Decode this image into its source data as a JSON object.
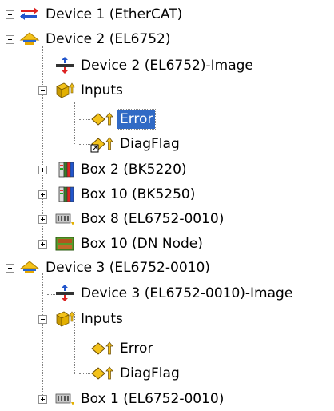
{
  "tree": {
    "selected_label": "Error",
    "nodes": [
      {
        "label": "Device 1 (EtherCAT)",
        "icon": "ethercat-device-icon",
        "expanded": false
      },
      {
        "label": "Device 2 (EL6752)",
        "icon": "device-icon",
        "expanded": true
      },
      {
        "label": "Device 2 (EL6752)-Image",
        "icon": "image-icon"
      },
      {
        "label": "Inputs",
        "icon": "inputs-icon",
        "expanded": true
      },
      {
        "label": "Error",
        "icon": "input-variable-icon",
        "selected": true
      },
      {
        "label": "DiagFlag",
        "icon": "linked-input-variable-icon"
      },
      {
        "label": "Box 2 (BK5220)",
        "icon": "bus-coupler-icon",
        "expanded": false
      },
      {
        "label": "Box 10 (BK5250)",
        "icon": "bus-coupler-icon",
        "expanded": false
      },
      {
        "label": "Box 8 (EL6752-0010)",
        "icon": "slave-box-icon",
        "expanded": false
      },
      {
        "label": "Box 10 (DN Node)",
        "icon": "dn-node-icon",
        "expanded": false
      },
      {
        "label": "Device 3 (EL6752-0010)",
        "icon": "device-icon",
        "expanded": true
      },
      {
        "label": "Device 3 (EL6752-0010)-Image",
        "icon": "image-icon"
      },
      {
        "label": "Inputs",
        "icon": "inputs-icon",
        "expanded": true
      },
      {
        "label": "Error",
        "icon": "input-variable-icon"
      },
      {
        "label": "DiagFlag",
        "icon": "input-variable-icon"
      },
      {
        "label": "Box 1 (EL6752-0010)",
        "icon": "slave-box-icon",
        "expanded": false
      }
    ]
  },
  "colors": {
    "selection": "#316ac5",
    "connector": "#808080"
  }
}
